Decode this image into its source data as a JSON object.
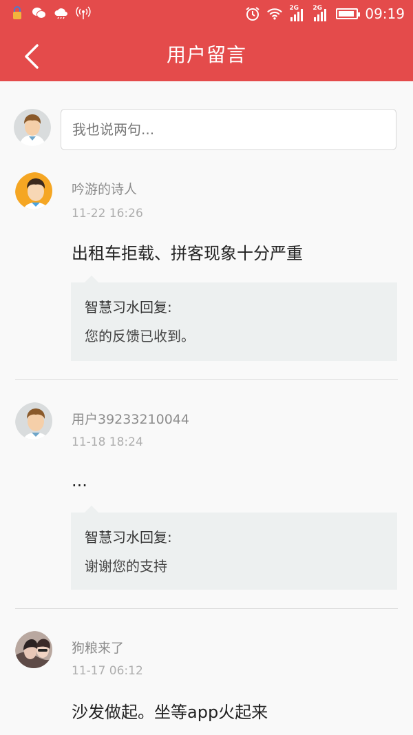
{
  "status_bar": {
    "time": "09:19",
    "net1": "2G",
    "net2": "2G",
    "battery_level": 0.9,
    "icons": [
      "lock-icon",
      "wechat-icon",
      "cloud-icon",
      "hotspot-icon",
      "alarm-icon",
      "wifi-icon",
      "signal-icon",
      "battery-icon"
    ]
  },
  "header": {
    "title": "用户留言",
    "back_icon": "chevron-left-icon"
  },
  "composer": {
    "placeholder": "我也说两句..."
  },
  "comments": [
    {
      "username": "吟游的诗人",
      "time": "11-22 16:26",
      "text": "出租车拒载、拼客现象十分严重",
      "reply_author": "智慧习水回复:",
      "reply_text": "您的反馈已收到。"
    },
    {
      "username": "用户39233210044",
      "time": "11-18 18:24",
      "text": "...",
      "reply_author": "智慧习水回复:",
      "reply_text": "谢谢您的支持"
    },
    {
      "username": "狗粮来了",
      "time": "11-17 06:12",
      "text": "沙发做起。坐等app火起来"
    }
  ],
  "colors": {
    "brand": "#e44b4b",
    "reply_bg": "#edf0f0"
  }
}
